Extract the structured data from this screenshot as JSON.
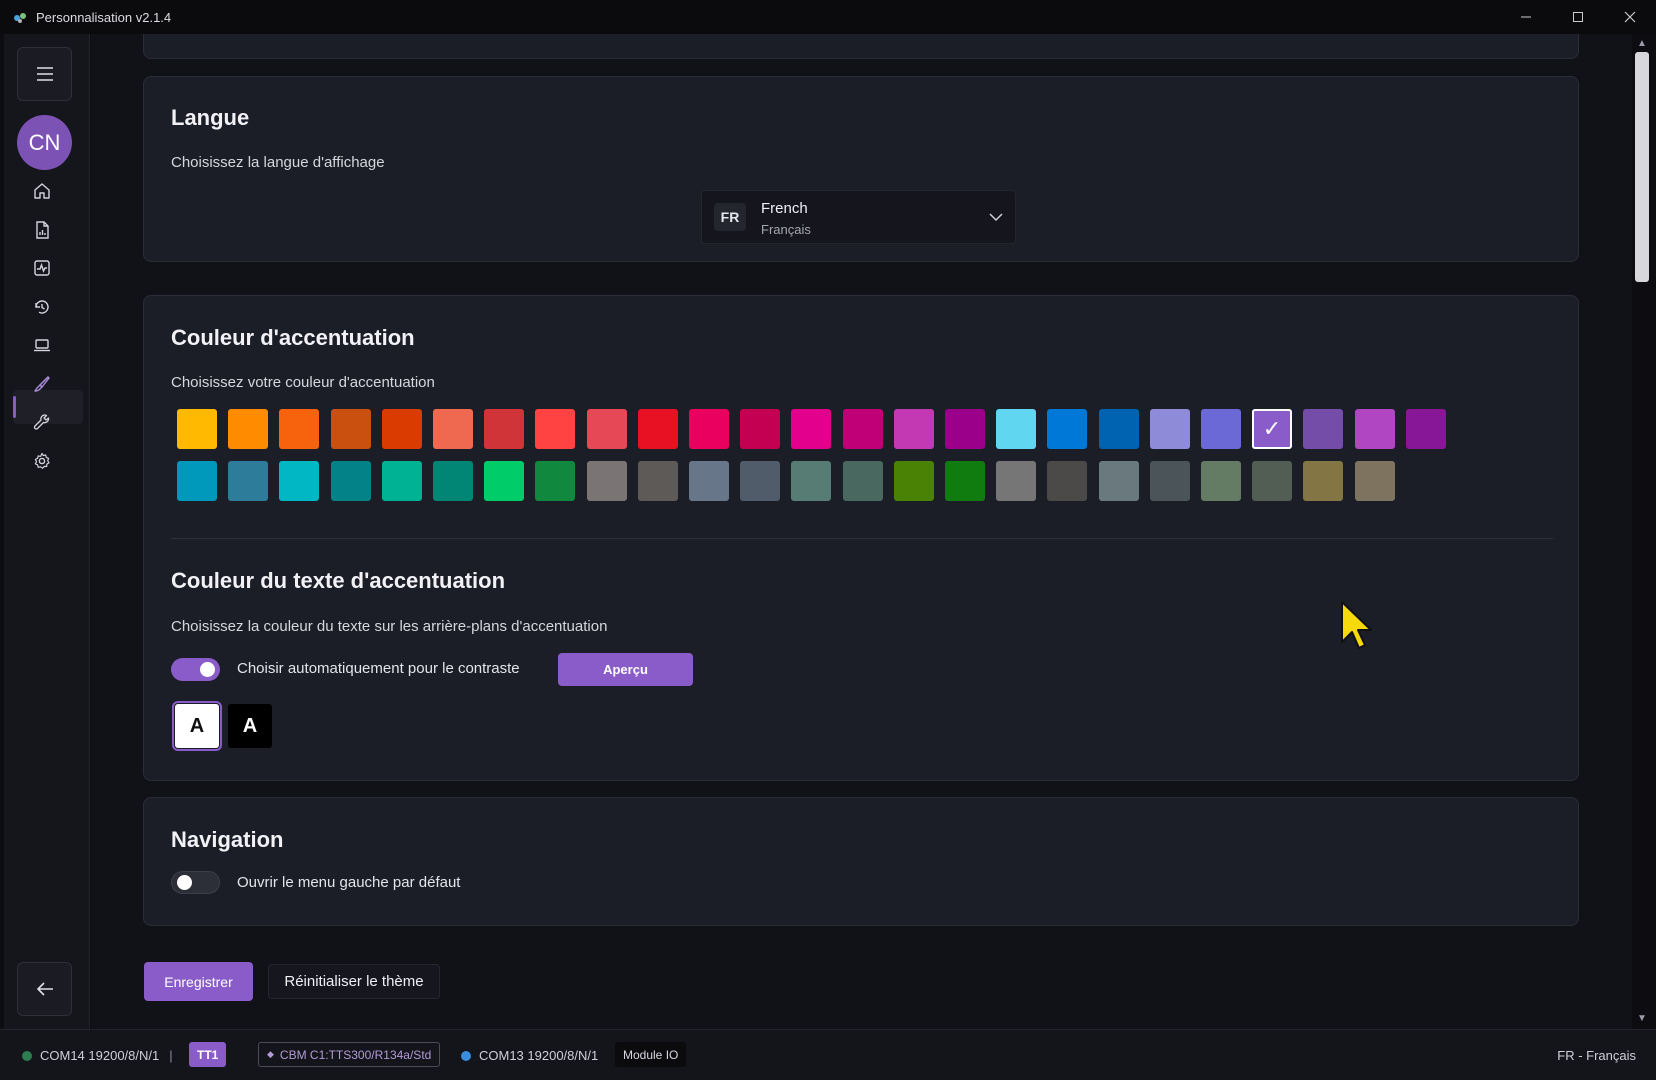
{
  "window": {
    "title": "Personnalisation v2.1.4"
  },
  "sidebar": {
    "avatar_initials": "CN",
    "items": [
      {
        "icon": "home-icon"
      },
      {
        "icon": "report-icon"
      },
      {
        "icon": "activity-icon"
      },
      {
        "icon": "history-icon"
      },
      {
        "icon": "laptop-icon"
      },
      {
        "icon": "brush-icon",
        "active": true
      },
      {
        "icon": "wrench-icon"
      },
      {
        "icon": "gear-icon"
      }
    ]
  },
  "language": {
    "title": "Langue",
    "description": "Choisissez la langue d'affichage",
    "selected_code": "FR",
    "selected_name": "French",
    "selected_native": "Français"
  },
  "accent": {
    "title": "Couleur d'accentuation",
    "description": "Choisissez votre couleur d'accentuation",
    "selected_index": 21,
    "colors_row1": [
      "#ffb900",
      "#ff8c00",
      "#f7630c",
      "#ca5010",
      "#da3b01",
      "#ef6950",
      "#d13438",
      "#ff4343",
      "#e74856",
      "#e81123",
      "#ea005e",
      "#c30052",
      "#e3008c",
      "#bf0077",
      "#c239b3",
      "#9a0089",
      "#60d6f0",
      "#0078d7",
      "#0063b1",
      "#8e8cd8",
      "#6b69d6",
      "#8a5cc9",
      "#744da9",
      "#b146c2",
      "#881798"
    ],
    "colors_row2": [
      "#0099bc",
      "#2d7d9a",
      "#00b7c3",
      "#038387",
      "#00b294",
      "#018574",
      "#00cc6a",
      "#10893e",
      "#7a7574",
      "#5d5a58",
      "#68768a",
      "#515c6b",
      "#567c73",
      "#486860",
      "#498205",
      "#107c10",
      "#767676",
      "#4c4a48",
      "#69797e",
      "#4a5459",
      "#647c64",
      "#525e54",
      "#847545",
      "#7e735f"
    ]
  },
  "accent_text": {
    "title": "Couleur du texte d'accentuation",
    "description": "Choisissez la couleur du texte sur les arrière-plans d'accentuation",
    "auto_label": "Choisir automatiquement pour le contraste",
    "auto_enabled": true,
    "preview_label": "Aperçu",
    "white_option": "A",
    "black_option": "A"
  },
  "navigation": {
    "title": "Navigation",
    "open_left_menu_label": "Ouvrir le menu gauche par défaut",
    "open_left_menu_enabled": false
  },
  "actions": {
    "save_label": "Enregistrer",
    "reset_label": "Réinitialiser le thème"
  },
  "statusbar": {
    "port1": "COM14 19200/8/N/1",
    "separator": "|",
    "port1_badge": "TT1",
    "device_chip": "CBM C1:TTS300/R134a/Std",
    "port2": "COM13 19200/8/N/1",
    "module_chip": "Module IO",
    "locale": "FR - Français"
  },
  "colors": {
    "accent": "#8a5cc9",
    "status_green": "#2e7d4f",
    "status_blue": "#3a8dde"
  }
}
